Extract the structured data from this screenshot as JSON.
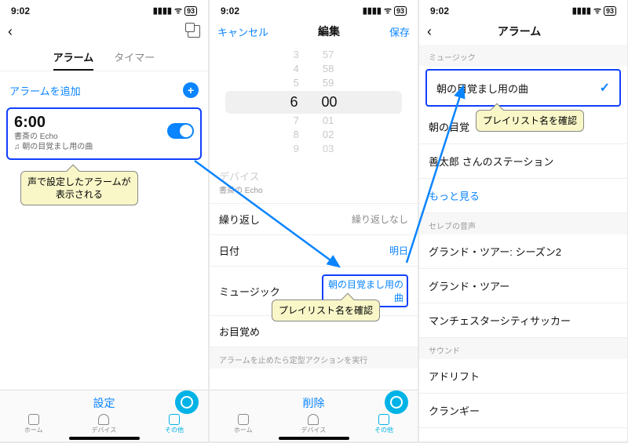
{
  "status": {
    "time": "9:02",
    "signal": "▮▮▮▮",
    "wifi": "ᯤ",
    "battery": "93"
  },
  "screen1": {
    "tabs": {
      "alarm": "アラーム",
      "timer": "タイマー"
    },
    "addLabel": "アラームを追加",
    "alarm": {
      "time": "6:00",
      "device": "書斎の Echo",
      "music": "♫ 朝の目覚まし用の曲"
    },
    "callout": "声で設定したアラームが\n表示される",
    "bottomButton": "設定",
    "tabbar": {
      "home": "ホーム",
      "device": "デバイス",
      "more": "その他"
    }
  },
  "screen2": {
    "nav": {
      "cancel": "キャンセル",
      "title": "編集",
      "save": "保存"
    },
    "picker": {
      "rows": [
        [
          "3",
          "57"
        ],
        [
          "4",
          "58"
        ],
        [
          "5",
          "59"
        ],
        [
          "6",
          "00"
        ],
        [
          "7",
          "01"
        ],
        [
          "8",
          "02"
        ],
        [
          "9",
          "03"
        ]
      ]
    },
    "deviceLabel": "デバイス",
    "deviceValue": "書斎の Echo",
    "repeatLabel": "繰り返し",
    "repeatValue": "繰り返しなし",
    "dateLabel": "日付",
    "dateValue": "明日",
    "musicLabel": "ミュージック",
    "musicValue": "朝の目覚まし用の曲",
    "wakeLabel": "お目覚め",
    "routineLabel": "アラームを止めたら定型アクションを実行",
    "callout": "プレイリスト名を確認",
    "bottomButton": "削除"
  },
  "screen3": {
    "title": "アラーム",
    "sections": {
      "music": "ミュージック",
      "celeb": "セレブの音声",
      "sound": "サウンド"
    },
    "items": {
      "m1": "朝の目覚まし用の曲",
      "m2": "朝の目覚",
      "m3": "善太郎 さんのステーション",
      "more": "もっと見る",
      "c1": "グランド・ツアー: シーズン2",
      "c2": "グランド・ツアー",
      "c3": "マンチェスターシティサッカー",
      "s1": "アドリフト",
      "s2": "クランギー"
    },
    "callout": "プレイリスト名を確認"
  }
}
